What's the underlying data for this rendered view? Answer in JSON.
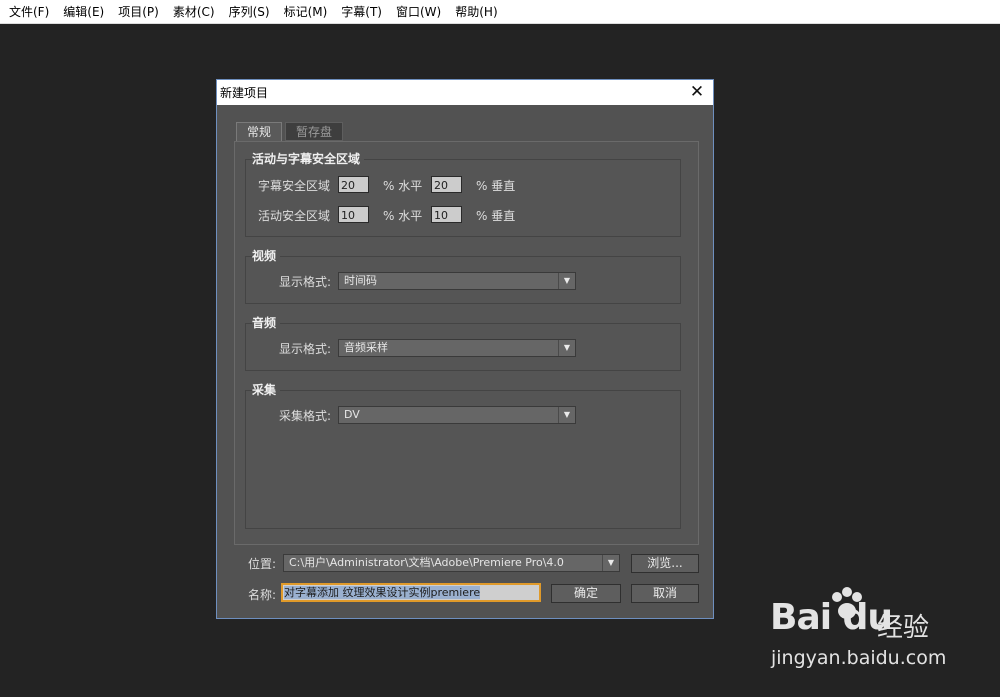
{
  "menubar": {
    "items": [
      "文件(F)",
      "编辑(E)",
      "项目(P)",
      "素材(C)",
      "序列(S)",
      "标记(M)",
      "字幕(T)",
      "窗口(W)",
      "帮助(H)"
    ]
  },
  "dialog": {
    "title": "新建项目",
    "close_glyph": "✕",
    "tabs": [
      "常规",
      "暂存盘"
    ],
    "safe_area": {
      "title": "活动与字幕安全区域",
      "title_safe_label": "字幕安全区域",
      "title_safe_h": "20",
      "title_safe_v": "20",
      "action_safe_label": "活动安全区域",
      "action_safe_h": "10",
      "action_safe_v": "10",
      "pct_horizontal": "% 水平",
      "pct_vertical": "% 垂直"
    },
    "video": {
      "title": "视频",
      "format_label": "显示格式:",
      "format_value": "时间码"
    },
    "audio": {
      "title": "音频",
      "format_label": "显示格式:",
      "format_value": "音频采样"
    },
    "capture": {
      "title": "采集",
      "format_label": "采集格式:",
      "format_value": "DV"
    },
    "location": {
      "label": "位置:",
      "path": "C:\\用户\\Administrator\\文档\\Adobe\\Premiere Pro\\4.0",
      "browse_label": "浏览..."
    },
    "name": {
      "label": "名称:",
      "value_selected": "对字幕添加 纹理效果设计实例",
      "value_rest": "premiere"
    },
    "ok_label": "确定",
    "cancel_label": "取消"
  },
  "watermark": {
    "logo": "Baidu经验",
    "logo_brand": "Bai du",
    "logo_suffix": "经验",
    "url": "jingyan.baidu.com"
  },
  "icons": {
    "dropdown": "chevron-down-icon",
    "close": "close-icon",
    "paw": "baidu-paw-icon"
  },
  "colors": {
    "background": "#232323",
    "dialog": "#525252",
    "input_focus_border": "#e09a2a"
  }
}
